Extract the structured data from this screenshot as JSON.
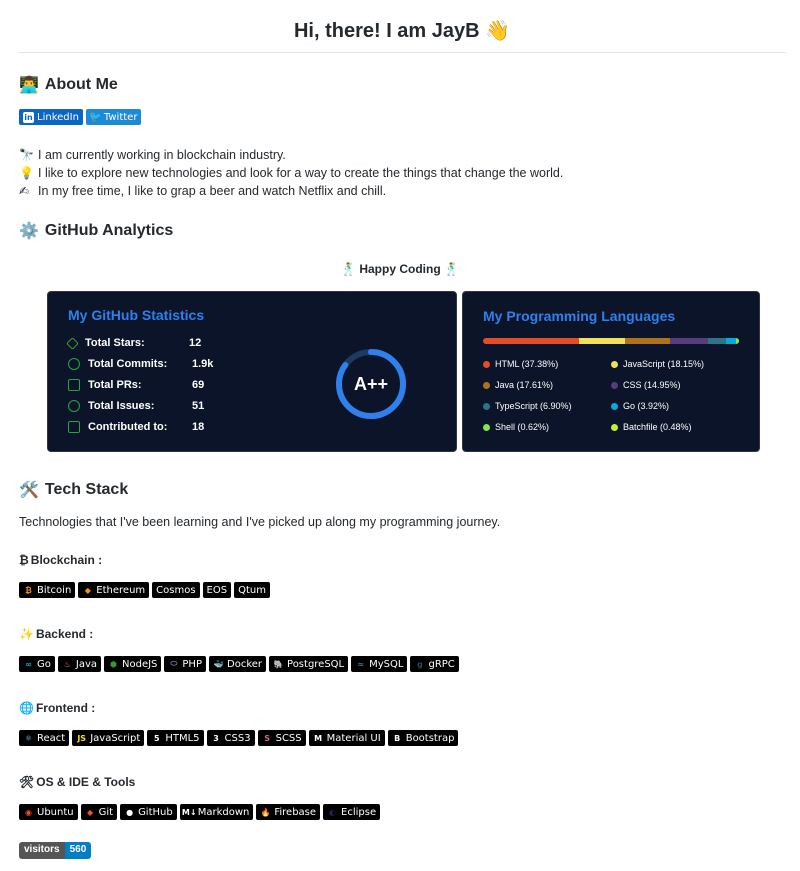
{
  "header": {
    "title": "Hi, there! I am JayB",
    "emoji": "👋"
  },
  "about": {
    "heading": "About Me",
    "heading_icon": "technologist",
    "links": [
      {
        "label": "LinkedIn",
        "icon": "in",
        "color": "#0a66c2"
      },
      {
        "label": "Twitter",
        "icon": "twitter-bird",
        "color": "#1d8ad6"
      }
    ],
    "lines": [
      {
        "emoji": "🔭",
        "text": "I am currently working in blockchain industry."
      },
      {
        "emoji": "💡",
        "text": "I like to explore new technologies and look for a way to create the things that change the world."
      },
      {
        "emoji": "✍",
        "text": "In my free time, I like to grap a beer and watch Netflix and chill."
      }
    ]
  },
  "analytics": {
    "heading": "GitHub Analytics",
    "heading_icon": "gear",
    "tagline": "Happy Coding",
    "stats_card": {
      "title": "My GitHub Statistics",
      "rows": [
        {
          "label": "Total Stars:",
          "value": "12",
          "icon": "star-icon"
        },
        {
          "label": "Total Commits:",
          "value": "1.9k",
          "icon": "history-icon"
        },
        {
          "label": "Total PRs:",
          "value": "69",
          "icon": "pull-request-icon"
        },
        {
          "label": "Total Issues:",
          "value": "51",
          "icon": "issue-icon"
        },
        {
          "label": "Contributed to:",
          "value": "18",
          "icon": "repo-icon"
        }
      ],
      "grade": "A++",
      "grade_progress": 0.85
    },
    "lang_card": {
      "title": "My Programming Languages",
      "languages": [
        {
          "name": "HTML (37.38%)",
          "pct": 37.38,
          "color": "#e34c26"
        },
        {
          "name": "JavaScript (18.15%)",
          "pct": 18.15,
          "color": "#f1e05a"
        },
        {
          "name": "Java (17.61%)",
          "pct": 17.61,
          "color": "#b07219"
        },
        {
          "name": "CSS (14.95%)",
          "pct": 14.95,
          "color": "#563d7c"
        },
        {
          "name": "TypeScript (6.90%)",
          "pct": 6.9,
          "color": "#2b7489"
        },
        {
          "name": "Go (3.92%)",
          "pct": 3.92,
          "color": "#00add8"
        },
        {
          "name": "Shell (0.62%)",
          "pct": 0.62,
          "color": "#89e051"
        },
        {
          "name": "Batchfile (0.48%)",
          "pct": 0.48,
          "color": "#c1f12e"
        }
      ]
    }
  },
  "tech": {
    "heading": "Tech Stack",
    "heading_icon": "hammer-wrench",
    "intro": "Technologies that I've been learning and I've picked up along my programming journey.",
    "groups": [
      {
        "label": "Blockchain :",
        "emoji": "₿",
        "badges": [
          {
            "label": "Bitcoin",
            "icon": "₿",
            "icon_color": "#f7931a"
          },
          {
            "label": "Ethereum",
            "icon": "◆",
            "icon_color": "#f7931a"
          },
          {
            "label": "Cosmos",
            "icon": "",
            "icon_color": ""
          },
          {
            "label": "EOS",
            "icon": "",
            "icon_color": ""
          },
          {
            "label": "Qtum",
            "icon": "",
            "icon_color": ""
          }
        ]
      },
      {
        "label": "Backend :",
        "emoji": "✨",
        "badges": [
          {
            "label": "Go",
            "icon": "∞",
            "icon_color": "#00add8"
          },
          {
            "label": "Java",
            "icon": "♨",
            "icon_color": "#f89820"
          },
          {
            "label": "NodeJS",
            "icon": "⬢",
            "icon_color": "#339933"
          },
          {
            "label": "PHP",
            "icon": "⬭",
            "icon_color": "#777bb4"
          },
          {
            "label": "Docker",
            "icon": "🐳",
            "icon_color": "#2496ed"
          },
          {
            "label": "PostgreSQL",
            "icon": "🐘",
            "icon_color": "#336791"
          },
          {
            "label": "MySQL",
            "icon": "≈",
            "icon_color": "#4479a1"
          },
          {
            "label": "gRPC",
            "icon": "g",
            "icon_color": "#244c5a"
          }
        ]
      },
      {
        "label": "Frontend :",
        "emoji": "🌐",
        "badges": [
          {
            "label": "React",
            "icon": "⚛",
            "icon_color": "#61dafb"
          },
          {
            "label": "JavaScript",
            "icon": "JS",
            "icon_color": "#f7df1e"
          },
          {
            "label": "HTML5",
            "icon": "5",
            "icon_color": "#ffffff"
          },
          {
            "label": "CSS3",
            "icon": "3",
            "icon_color": "#ffffff"
          },
          {
            "label": "SCSS",
            "icon": "S",
            "icon_color": "#cc6699"
          },
          {
            "label": "Material UI",
            "icon": "M",
            "icon_color": "#ffffff"
          },
          {
            "label": "Bootstrap",
            "icon": "B",
            "icon_color": "#ffffff"
          }
        ]
      },
      {
        "label": "OS & IDE & Tools",
        "emoji": "🛠",
        "badges": [
          {
            "label": "Ubuntu",
            "icon": "◉",
            "icon_color": "#e95420"
          },
          {
            "label": "Git",
            "icon": "◆",
            "icon_color": "#f05032"
          },
          {
            "label": "GitHub",
            "icon": "●",
            "icon_color": "#ffffff"
          },
          {
            "label": "Markdown",
            "icon": "M↓",
            "icon_color": "#ffffff"
          },
          {
            "label": "Firebase",
            "icon": "🔥",
            "icon_color": "#ffca28"
          },
          {
            "label": "Eclipse",
            "icon": "◐",
            "icon_color": "#2c2255"
          }
        ]
      }
    ]
  },
  "visitors": {
    "label": "visitors",
    "count": "560"
  }
}
